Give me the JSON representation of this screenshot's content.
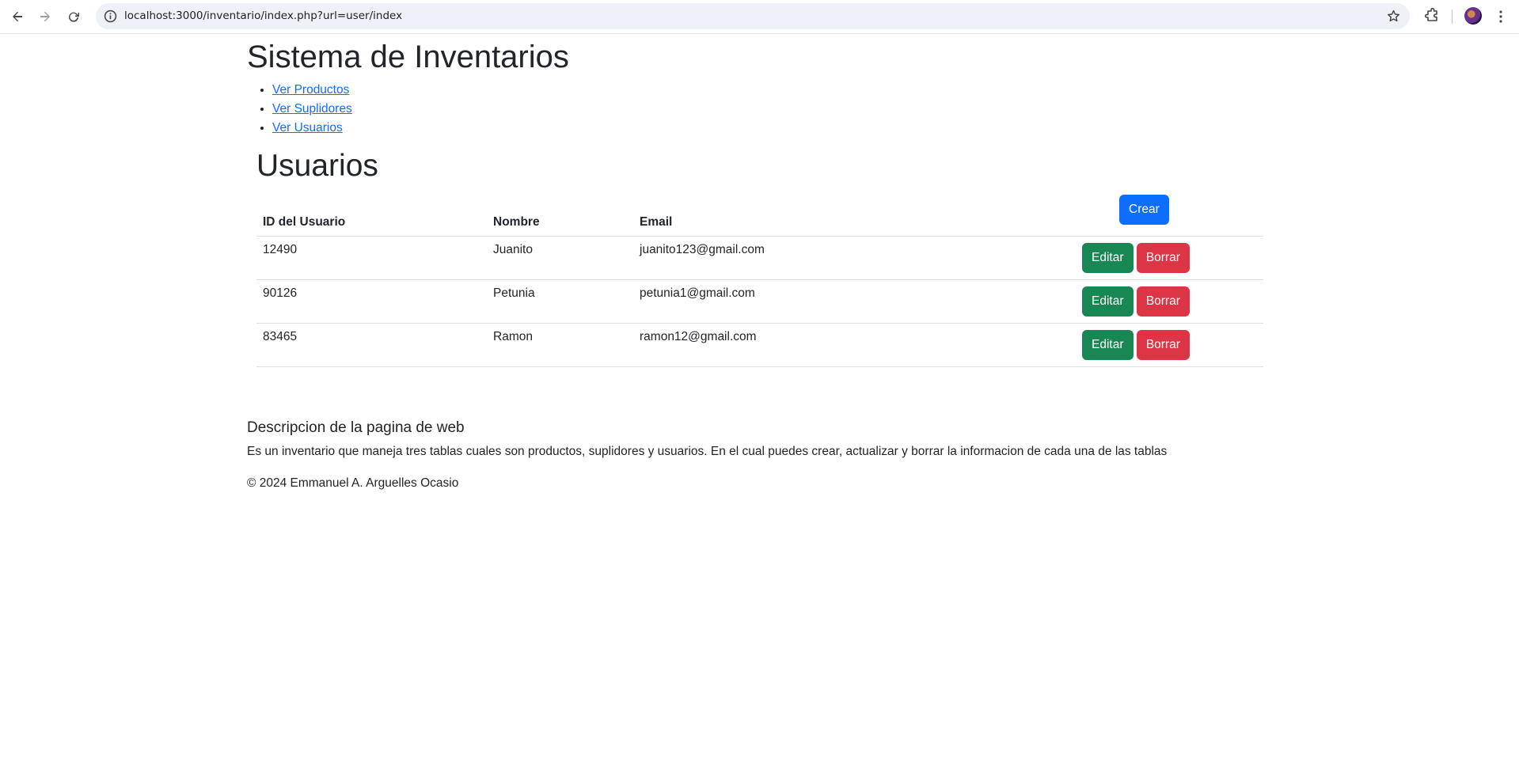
{
  "browser": {
    "url": "localhost:3000/inventario/index.php?url=user/index"
  },
  "site": {
    "title": "Sistema de Inventarios",
    "nav": [
      {
        "label": "Ver Productos"
      },
      {
        "label": "Ver Suplidores"
      },
      {
        "label": "Ver Usuarios"
      }
    ]
  },
  "users": {
    "title": "Usuarios",
    "columns": {
      "id": "ID del Usuario",
      "name": "Nombre",
      "email": "Email"
    },
    "create_label": "Crear",
    "edit_label": "Editar",
    "delete_label": "Borrar",
    "rows": [
      {
        "id": "12490",
        "name": "Juanito",
        "email": "juanito123@gmail.com"
      },
      {
        "id": "90126",
        "name": "Petunia",
        "email": "petunia1@gmail.com"
      },
      {
        "id": "83465",
        "name": "Ramon",
        "email": "ramon12@gmail.com"
      }
    ]
  },
  "footer": {
    "heading": "Descripcion de la pagina de web",
    "description": "Es un inventario que maneja tres tablas cuales son productos, suplidores y usuarios. En el cual puedes crear, actualizar y borrar la informacion de cada una de las tablas",
    "copyright": "© 2024 Emmanuel A. Arguelles Ocasio"
  },
  "colors": {
    "primary": "#0d6efd",
    "success": "#198754",
    "danger": "#dc3545",
    "link": "#0d6efd"
  }
}
